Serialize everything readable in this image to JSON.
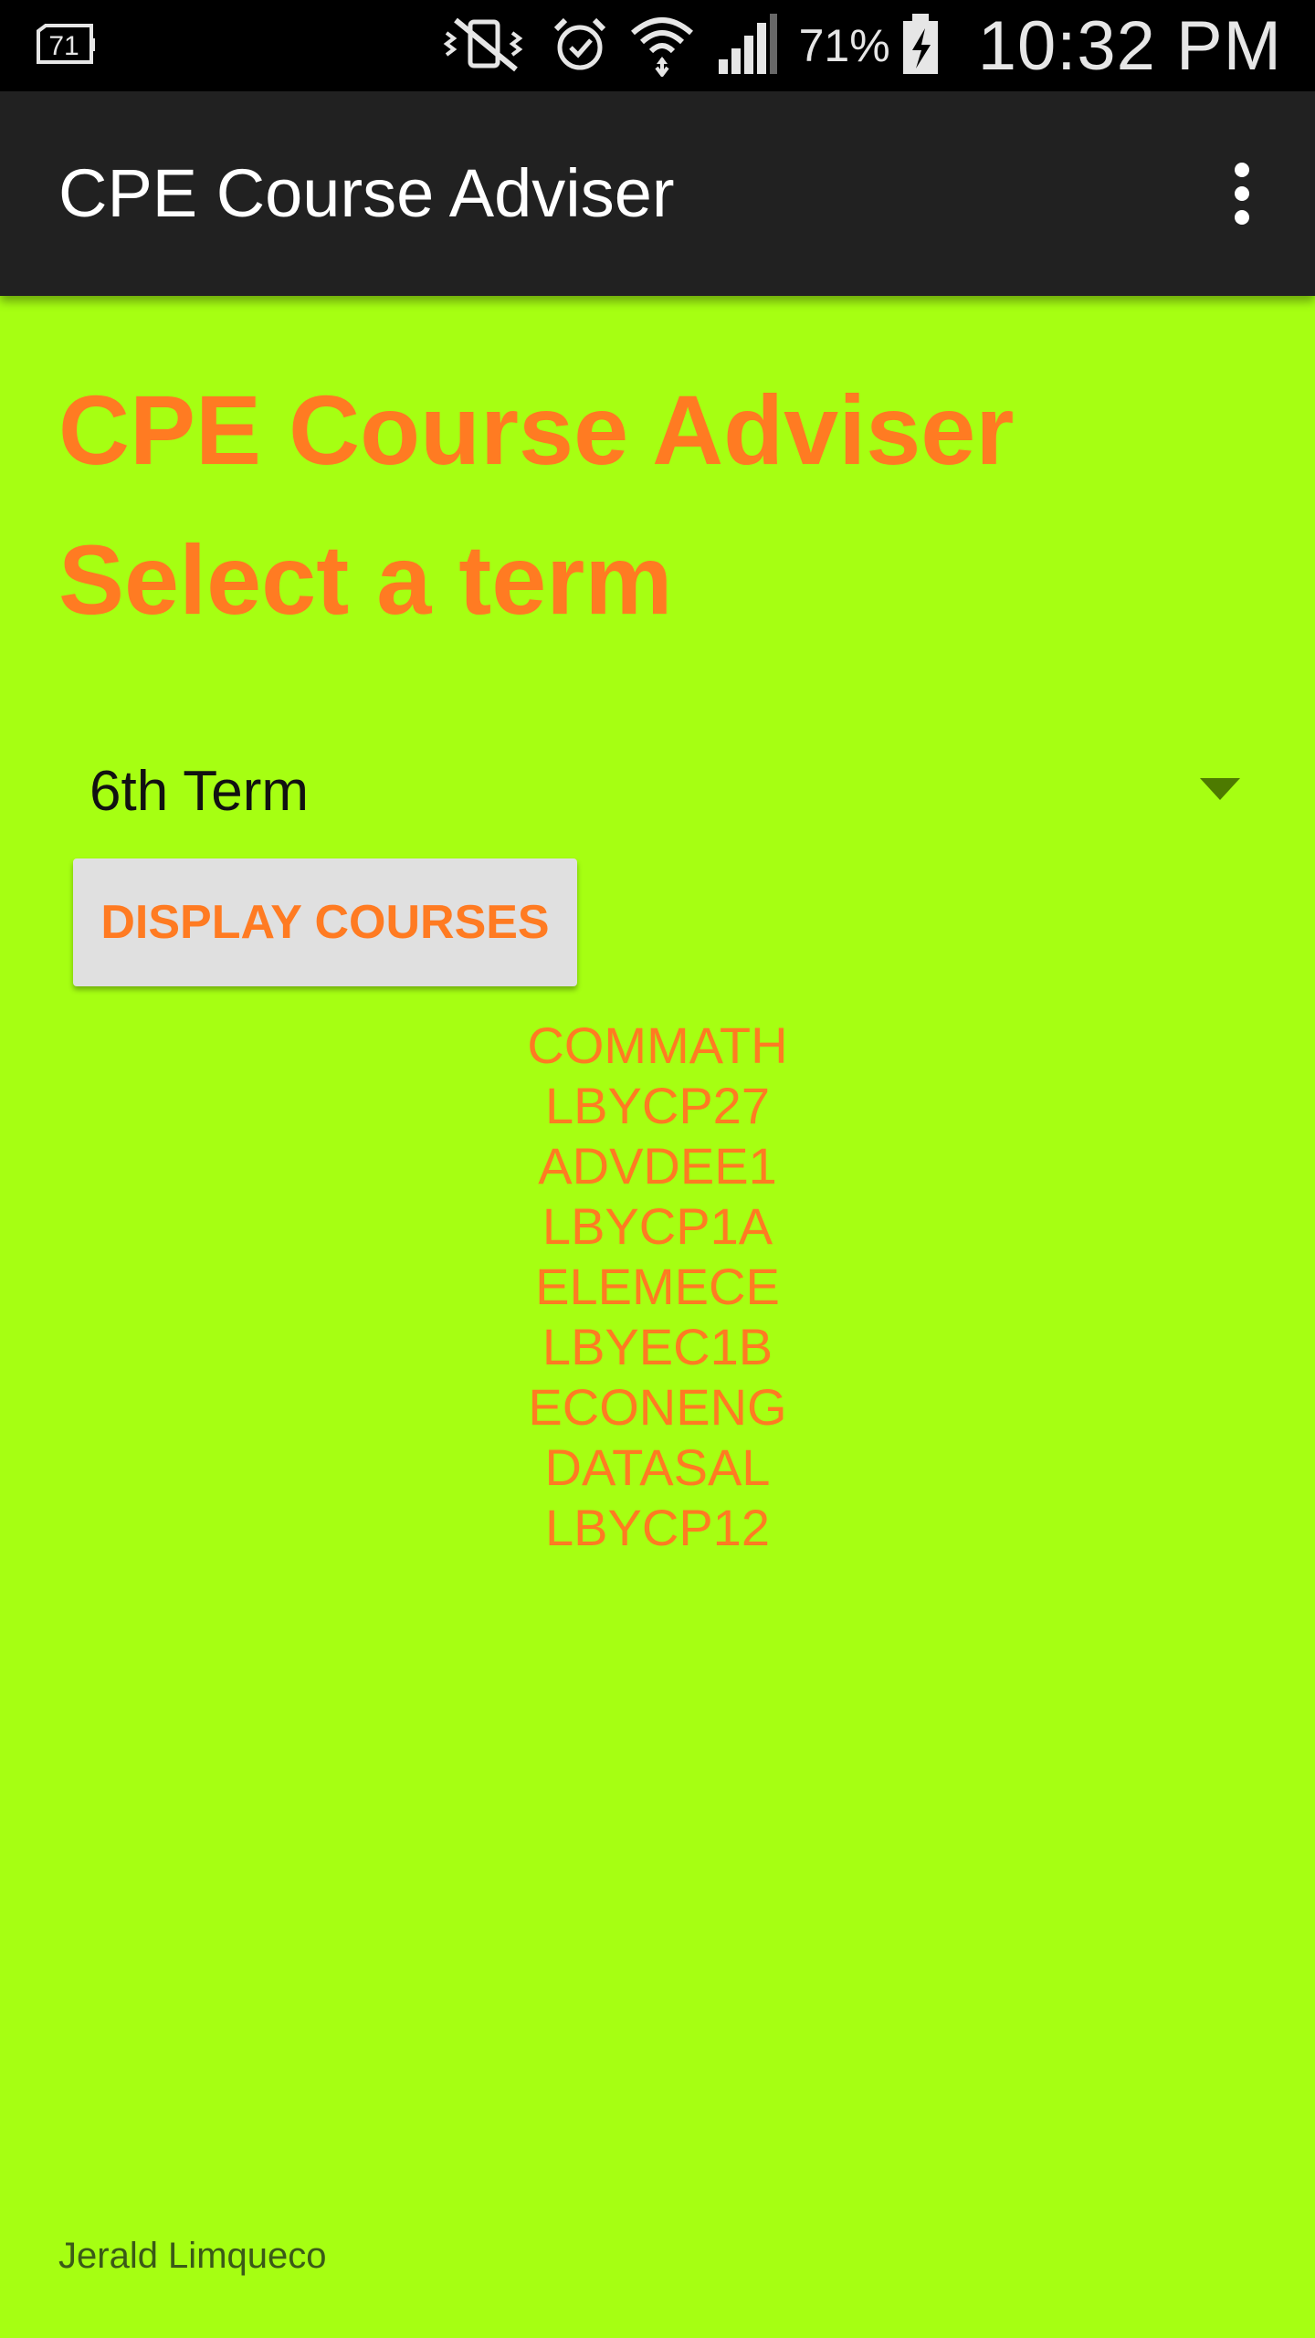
{
  "status_bar": {
    "left_icon": "notification-71-icon",
    "left_icon_text": "71",
    "icons": [
      "vibrate-mute-icon",
      "alarm-icon",
      "wifi-icon",
      "cell-signal-icon"
    ],
    "battery_percent": "71%",
    "battery_icon": "battery-charging-icon",
    "time": "10:32 PM"
  },
  "app_bar": {
    "title": "CPE Course Adviser",
    "overflow_icon": "more-vert-icon"
  },
  "main": {
    "heading": "CPE Course Adviser",
    "subheading": "Select a term",
    "term_spinner": {
      "selected": "6th Term",
      "icon": "dropdown-arrow-icon"
    },
    "display_button_label": "DISPLAY COURSES",
    "courses": [
      "COMMATH",
      "LBYCP27",
      "ADVDEE1",
      "LBYCP1A",
      "ELEMECE",
      "LBYEC1B",
      "ECONENG",
      "DATASAL",
      "LBYCP12"
    ],
    "footer": "Jerald Limqueco"
  },
  "colors": {
    "background": "#a6ff12",
    "accent": "#ff7b22",
    "app_bar": "#212121",
    "status_bar": "#000000",
    "button": "#e0e0e0"
  }
}
